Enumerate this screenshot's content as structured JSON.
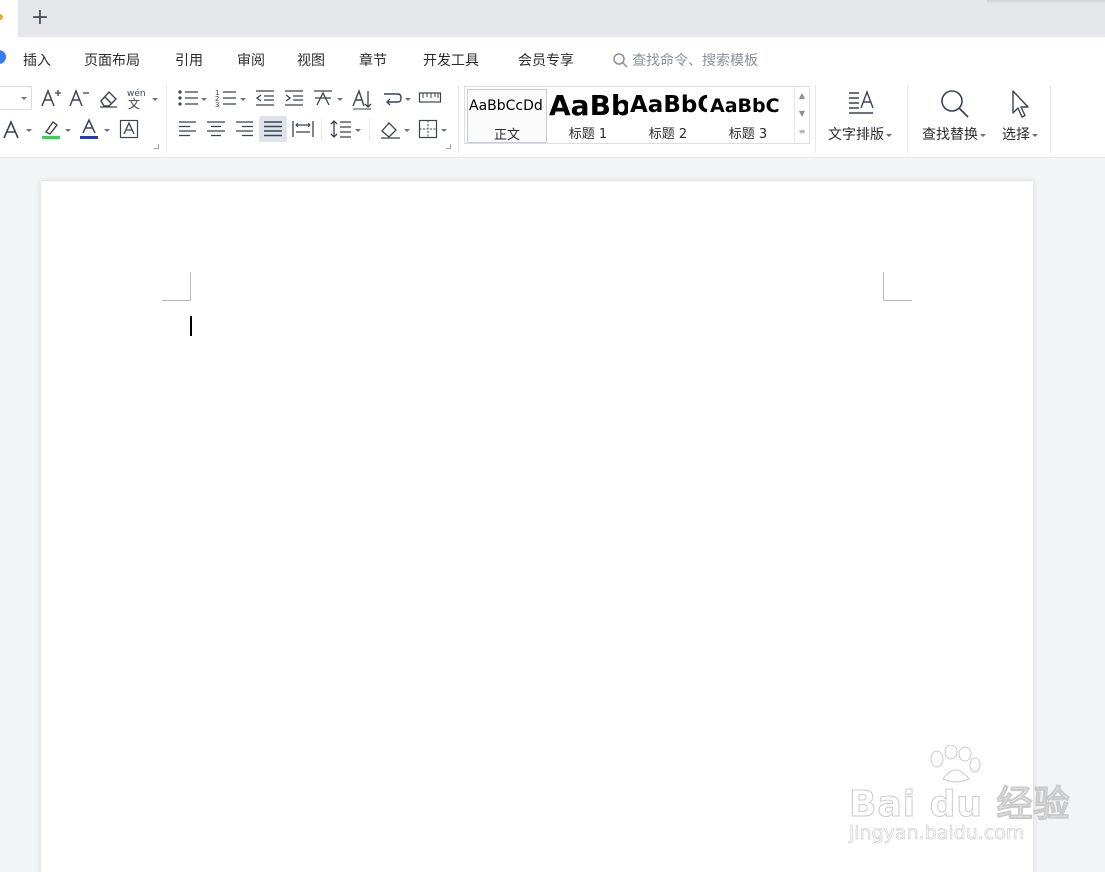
{
  "tabbar": {
    "new_tab_label": "+"
  },
  "menu": {
    "items": [
      "插入",
      "页面布局",
      "引用",
      "审阅",
      "视图",
      "章节",
      "开发工具",
      "会员专享"
    ],
    "search_placeholder": "查找命令、搜索模板"
  },
  "ribbon": {
    "font_color_letter": "A",
    "styles": [
      {
        "sample": "AaBbCcDd",
        "name": "正文"
      },
      {
        "sample": "AaBb",
        "name": "标题 1"
      },
      {
        "sample": "AaBbC",
        "name": "标题 2"
      },
      {
        "sample": "AaBbC",
        "name": "标题 3"
      }
    ],
    "text_layout_label": "文字排版",
    "find_replace_label": "查找替换",
    "select_label": "选择"
  },
  "colors": {
    "highlight": "#2fd84a",
    "font_color": "#1a3cc8",
    "accent": "#3a7bf2"
  },
  "watermark": {
    "brand": "Bai du 经验",
    "url": "jingyan.baidu.com"
  }
}
